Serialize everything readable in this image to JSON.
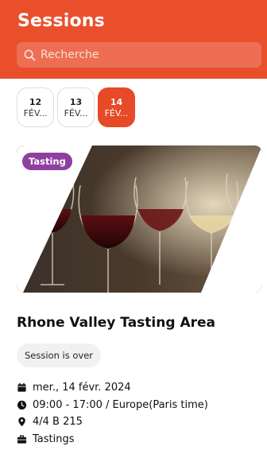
{
  "header": {
    "title": "Sessions",
    "search_placeholder": "Recherche",
    "search_icon": "search-icon"
  },
  "dates": [
    {
      "day": "12",
      "month": "FÉV...",
      "active": false
    },
    {
      "day": "13",
      "month": "FÉV...",
      "active": false
    },
    {
      "day": "14",
      "month": "FÉV...",
      "active": true
    }
  ],
  "session": {
    "tag": "Tasting",
    "image": "wine-glasses-image",
    "title": "Rhone Valley Tasting Area",
    "status": "Session is over",
    "date": "mer., 14 févr. 2024",
    "time": "09:00 - 17:00 / Europe(Paris time)",
    "location": "4/4 B 215",
    "category": "Tastings"
  },
  "colors": {
    "accent": "#ea4f2c",
    "tag": "#8e3fa0"
  }
}
